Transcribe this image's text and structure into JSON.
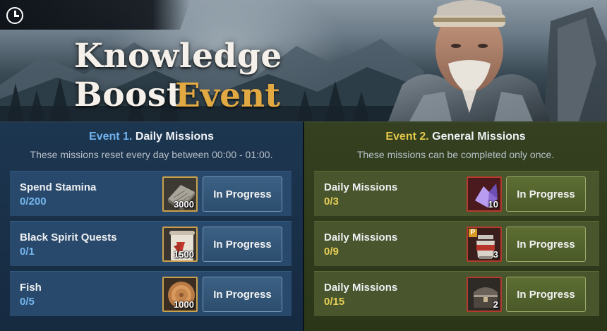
{
  "banner": {
    "title": "Knowledge Boost",
    "subtitle": "Event",
    "timer_icon": "clock-icon"
  },
  "event1": {
    "number": "Event 1.",
    "name": "Daily Missions",
    "description": "These missions reset every day between 00:00 - 01:00.",
    "accent_color": "#6fb2ec",
    "missions": [
      {
        "name": "Spend Stamina",
        "progress": "0/200",
        "reward_icon": "stamina-tablet-icon",
        "reward_qty": "3000",
        "button": "In Progress"
      },
      {
        "name": "Black Spirit Quests",
        "progress": "0/1",
        "reward_icon": "scroll-icon",
        "reward_qty": "1500",
        "button": "In Progress"
      },
      {
        "name": "Fish",
        "progress": "0/5",
        "reward_icon": "coin-icon",
        "reward_qty": "1000",
        "button": "In Progress"
      }
    ]
  },
  "event2": {
    "number": "Event 2.",
    "name": "General Missions",
    "description": "These missions can be completed only once.",
    "accent_color": "#e3c84a",
    "missions": [
      {
        "name": "Daily Missions",
        "progress": "0/3",
        "reward_icon": "crystal-icon",
        "reward_qty": "10",
        "button": "In Progress"
      },
      {
        "name": "Daily Missions",
        "progress": "0/9",
        "reward_icon": "elixir-jar-icon",
        "reward_qty": "3",
        "reward_badge": "P",
        "button": "In Progress"
      },
      {
        "name": "Daily Missions",
        "progress": "0/15",
        "reward_icon": "treasure-chest-icon",
        "reward_qty": "2",
        "button": "In Progress"
      }
    ]
  }
}
